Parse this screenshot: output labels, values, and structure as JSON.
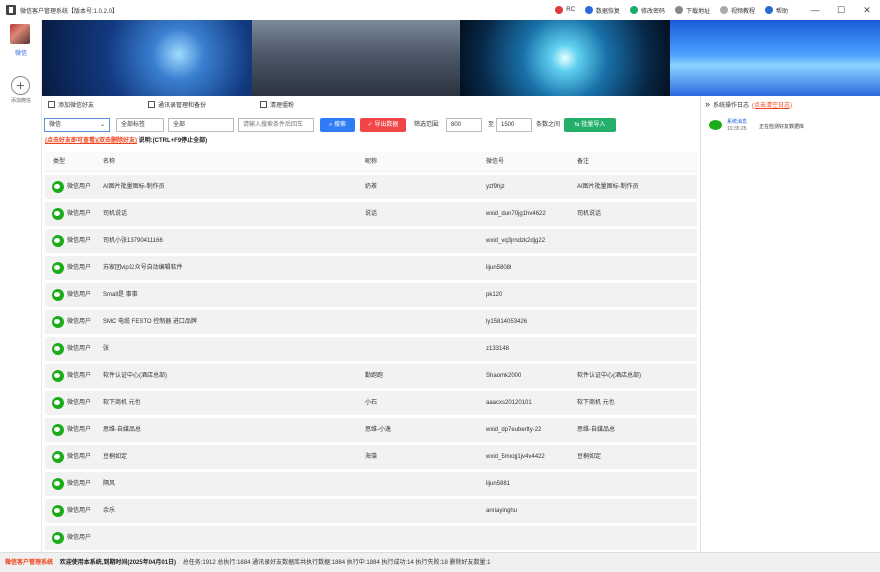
{
  "app": {
    "title": "微信客户管理系统【版本号:1.0.2.0】"
  },
  "window": {
    "min": "—",
    "max": "☐",
    "close": "✕"
  },
  "title_links": [
    {
      "label": "RC",
      "color": "#e03a3a"
    },
    {
      "label": "数据恢复",
      "color": "#2a6ad8"
    },
    {
      "label": "修改密码",
      "color": "#1aad6a"
    },
    {
      "label": "下载地址",
      "color": "#888888"
    },
    {
      "label": "视频教程",
      "color": "#aaaaaa"
    },
    {
      "label": "帮助",
      "color": "#2a6ad8"
    }
  ],
  "sidebar": {
    "account_label": "微信",
    "add_label": "添加微信",
    "add_symbol": "+"
  },
  "toolbar": {
    "tab1": "添加微信好友",
    "tab2": "通讯录管理和备份",
    "tab3": "清理僵粉"
  },
  "filters": {
    "type": "微信",
    "type_caret": "⌄",
    "group": "全部标签",
    "scope": "全部",
    "search_placeholder": "请输入搜索条件后回车",
    "search_btn": "搜索",
    "export_btn": "导出数据",
    "filter_label": "筛选范围:",
    "from": "800",
    "to_label": "至",
    "to": "1500",
    "between": "条数之间",
    "import_btn": "批量导入"
  },
  "notice": {
    "red": "(点击好友即可查看)(双击删除好友)",
    "black": "说明:(CTRL+F9停止全部)"
  },
  "columns": [
    "类型",
    "名称",
    "昵称",
    "微信号",
    "备注"
  ],
  "rows": [
    {
      "type": "微信用户",
      "name": "AI图片批量图标-制作员",
      "nick": "奶茶",
      "wxid": "yzf9hjz",
      "remark": "AI图片批量图标-制作员"
    },
    {
      "type": "微信用户",
      "name": "司机说话",
      "nick": "说话",
      "wxid": "wxid_dun70jg1hv4622",
      "remark": "司机说话"
    },
    {
      "type": "微信用户",
      "name": "司机小张13790411166",
      "nick": "",
      "wxid": "wxid_vq3jrndzk2djg22",
      "remark": ""
    },
    {
      "type": "微信用户",
      "name": "苏家团vip公众号自动编辑软件",
      "nick": "",
      "wxid": "lijun5808l",
      "remark": ""
    },
    {
      "type": "微信用户",
      "name": "Small是 事事",
      "nick": "",
      "wxid": "pk120",
      "remark": ""
    },
    {
      "type": "微信用户",
      "name": "SMC 电缆 FESTO 控制器 进口品牌",
      "nick": "",
      "wxid": "ly15814053426",
      "remark": ""
    },
    {
      "type": "微信用户",
      "name": "张",
      "nick": "",
      "wxid": "z133148",
      "remark": ""
    },
    {
      "type": "微信用户",
      "name": "软件认证中心(酒店总部)",
      "nick": "勤跑跑",
      "wxid": "Shaomk2000",
      "remark": "软件认证中心(酒店总部)"
    },
    {
      "type": "微信用户",
      "name": "软下商机 元也",
      "nick": "小石",
      "wxid": "aaacxs20120101",
      "remark": "软下商机 元也"
    },
    {
      "type": "微信用户",
      "name": "思维-自媒品总",
      "nick": "思维-小逸",
      "wxid": "wxid_dp7euberlty-22",
      "remark": "思维-自媒品总"
    },
    {
      "type": "微信用户",
      "name": "豆桐如定",
      "nick": "海藻",
      "wxid": "wxid_5mxqj1jv4v4422",
      "remark": "豆桐如定"
    },
    {
      "type": "微信用户",
      "name": "隔风",
      "nick": "",
      "wxid": "lijun5881",
      "remark": ""
    },
    {
      "type": "微信用户",
      "name": "余乐",
      "nick": "",
      "wxid": "anriayinghu",
      "remark": ""
    },
    {
      "type": "微信用户",
      "name": "",
      "nick": "",
      "wxid": "",
      "remark": ""
    }
  ],
  "right_panel": {
    "chevron": "»",
    "title": "系统操作日志",
    "link": "(点击清空日志)",
    "item_name": "系统消息",
    "item_time": "10:35:25",
    "item_msg": "正在检测好友数据库"
  },
  "status": {
    "brand": "微信客户管理系统",
    "welcome": "欢迎使用本系统,到期时间(2025年04月01日)",
    "stats": "总任务:1912 总执行:1884 通讯录好友数据库共执行数据:1884 执行中:1884 执行成功:14 执行失败:18 删除好友数量:1"
  }
}
